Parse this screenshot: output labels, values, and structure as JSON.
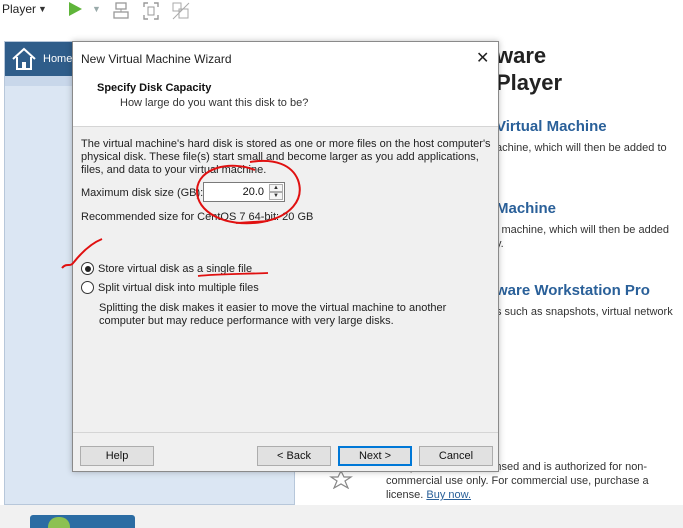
{
  "toolbar": {
    "player_menu": "Player",
    "icons": [
      "play-icon",
      "send-ctrl-alt-del-icon",
      "full-screen-icon",
      "unity-icon"
    ]
  },
  "library": {
    "home_label": "Home"
  },
  "welcome": {
    "brand_line1": "ware",
    "brand_line2": "Player",
    "sections": [
      {
        "heading": "Virtual Machine",
        "desc": "achine, which will then be added to"
      },
      {
        "heading": "Machine",
        "desc": "l machine, which will then be added\ny."
      },
      {
        "heading": "ware Workstation Pro",
        "desc": "s such as snapshots, virtual network"
      }
    ],
    "license_text": "This product is not licensed and is authorized for non-commercial use only. For commercial use, purchase a license.",
    "license_link": "Buy now."
  },
  "wizard": {
    "title": "New Virtual Machine Wizard",
    "header_title": "Specify Disk Capacity",
    "header_subtitle": "How large do you want this disk to be?",
    "description": "The virtual machine's hard disk is stored as one or more files on the host computer's physical disk. These file(s) start small and become larger as you add applications, files, and data to your virtual machine.",
    "max_size_label": "Maximum disk size (GB):",
    "max_size_value": "20.0",
    "recommended": "Recommended size for CentOS 7 64-bit: 20 GB",
    "options": [
      {
        "label": "Store virtual disk as a single file",
        "selected": true
      },
      {
        "label": "Split virtual disk into multiple files",
        "selected": false
      }
    ],
    "split_note": "Splitting the disk makes it easier to move the virtual machine to another computer but may reduce performance with very large disks.",
    "buttons": {
      "help": "Help",
      "back": "< Back",
      "next": "Next >",
      "cancel": "Cancel"
    }
  },
  "colors": {
    "accent": "#0078d7",
    "heading": "#2a6099",
    "annotation": "#e01010"
  }
}
